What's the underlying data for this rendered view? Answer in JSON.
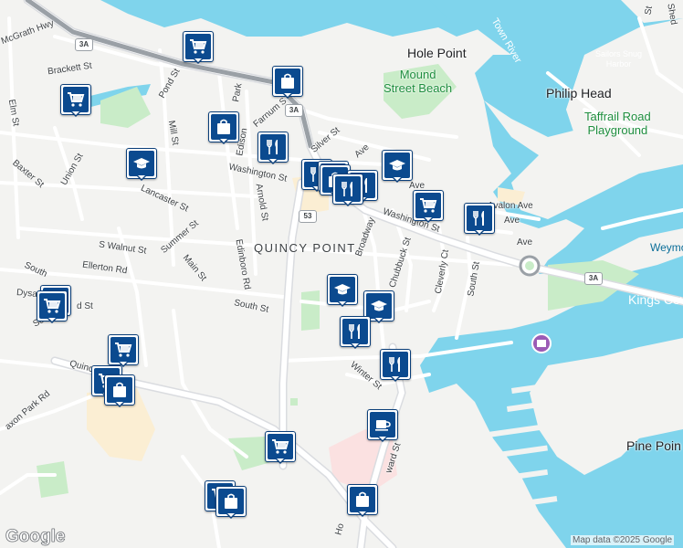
{
  "map": {
    "attribution": "Map data ©2025 Google",
    "logo": "Google",
    "neighborhood": "QUINCY POINT",
    "places": {
      "hole_point": "Hole Point",
      "philip_head": "Philip Head",
      "kings_cove": "Kings Cov",
      "pine_point": "Pine Poin",
      "mound_beach": "Mound\nStreet Beach",
      "taffrail": "Taffrail Road\nPlayground",
      "town_river": "Town River",
      "sailors_harbor": "Sailors Snug\nHarbor",
      "weymouth": "Weymo"
    },
    "route_shields": [
      "3A",
      "3A",
      "53",
      "3A"
    ],
    "streets": {
      "mcgrath": "McGrath Hwy",
      "brackett": "Brackett St",
      "pond": "Pond St",
      "elm": "Elm St",
      "edison_park": "Park",
      "farnum": "Farnum S",
      "silver": "Silver St",
      "ave1": "Ave",
      "mill": "Mill St",
      "edison": "Edison",
      "union": "Union St",
      "baxter": "Baxter St",
      "washington1": "Washington St",
      "washington2": "Washington St",
      "avalon": "Avalon Ave",
      "ave2": "Ave",
      "ave3": "Ave",
      "ave4": "Ave",
      "lancaster": "Lancaster St",
      "arnold": "Arnold St",
      "summer": "Summer St",
      "swalnut": "S Walnut St",
      "edinboro": "Edinboro Rd",
      "main": "Main St",
      "ellerton": "Ellerton Rd",
      "broadway": "Broadway",
      "chubbuck": "Chubbuck St",
      "cleverly": "Cleverly Ct",
      "south1": "South St",
      "south2": "South St",
      "south3": "South",
      "dysart": "Dysa",
      "scam": "Sca",
      "st_frag": "d St",
      "quincy": "Quinc",
      "saxon": "axon Park Rd",
      "winter": "Winter St",
      "howard": "ward St",
      "ho": "Ho",
      "shed": "Shed",
      "st_top": "St"
    },
    "markers": [
      {
        "icon": "cart-icon"
      },
      {
        "icon": "shopping-bag-icon"
      },
      {
        "icon": "cart-icon"
      },
      {
        "icon": "shopping-bag-icon"
      },
      {
        "icon": "restaurant-icon"
      },
      {
        "icon": "school-icon"
      },
      {
        "icon": "restaurant-icon"
      },
      {
        "icon": "restaurant-icon"
      },
      {
        "icon": "shopping-bag-icon"
      },
      {
        "icon": "restaurant-icon"
      },
      {
        "icon": "school-icon"
      },
      {
        "icon": "restaurant-icon"
      },
      {
        "icon": "cart-icon"
      },
      {
        "icon": "restaurant-icon"
      },
      {
        "icon": "school-icon"
      },
      {
        "icon": "school-icon"
      },
      {
        "icon": "restaurant-icon"
      },
      {
        "icon": "cart-icon"
      },
      {
        "icon": "cart-icon"
      },
      {
        "icon": "restaurant-icon"
      },
      {
        "icon": "cart-icon"
      },
      {
        "icon": "cart-icon"
      },
      {
        "icon": "shopping-bag-icon"
      },
      {
        "icon": "coffee-icon"
      },
      {
        "icon": "cart-icon"
      },
      {
        "icon": "cart-icon"
      },
      {
        "icon": "shopping-bag-icon"
      },
      {
        "icon": "shopping-bag-icon"
      }
    ],
    "colors": {
      "water": "#7fd4ec",
      "land": "#f3f3f1",
      "park": "#c9ecc8",
      "marker": "#0b4a8f"
    }
  }
}
